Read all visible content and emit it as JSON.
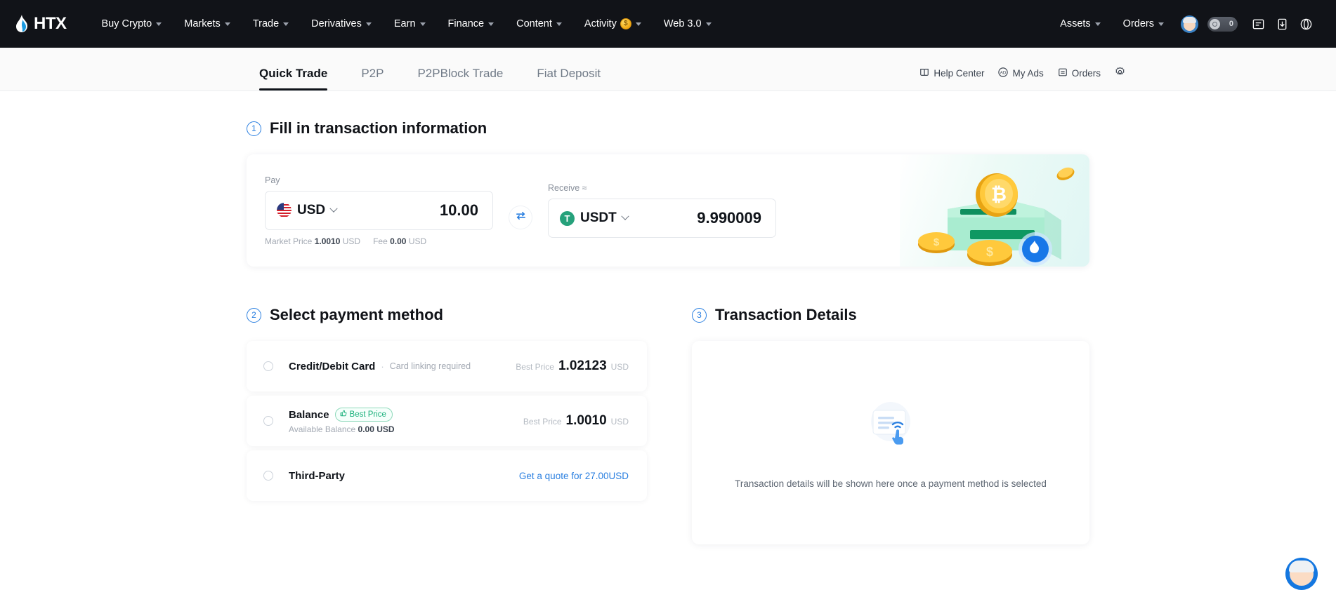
{
  "nav": {
    "brand": "HTX",
    "items": [
      {
        "label": "Buy Crypto",
        "caret": true
      },
      {
        "label": "Markets",
        "caret": true
      },
      {
        "label": "Trade",
        "caret": true
      },
      {
        "label": "Derivatives",
        "caret": true
      },
      {
        "label": "Earn",
        "caret": true
      },
      {
        "label": "Finance",
        "caret": true
      },
      {
        "label": "Content",
        "caret": true
      },
      {
        "label": "Activity",
        "caret": true,
        "badge": "$"
      },
      {
        "label": "Web 3.0",
        "caret": true
      }
    ],
    "right": {
      "assets": "Assets",
      "orders": "Orders",
      "pill_count": "0",
      "icons": [
        "avatar",
        "toggle-pill",
        "announcement-icon",
        "download-icon",
        "theme-icon"
      ]
    }
  },
  "subbar": {
    "tabs": [
      {
        "label": "Quick Trade",
        "active": true
      },
      {
        "label": "P2P",
        "active": false
      },
      {
        "label": "P2PBlock Trade",
        "active": false
      },
      {
        "label": "Fiat Deposit",
        "active": false
      }
    ],
    "links": [
      {
        "label": "Help Center",
        "icon": "book-icon"
      },
      {
        "label": "My Ads",
        "icon": "ad-icon"
      },
      {
        "label": "Orders",
        "icon": "orders-list-icon"
      }
    ],
    "settings_icon": "gear-icon"
  },
  "step1": {
    "number": "1",
    "title": "Fill in transaction information",
    "pay": {
      "label": "Pay",
      "currency": "USD",
      "currency_icon": "us-flag-icon",
      "amount": "10.00"
    },
    "receive": {
      "label": "Receive ≈",
      "currency": "USDT",
      "currency_icon": "usdt-icon",
      "amount": "9.990009"
    },
    "market_price_label": "Market Price",
    "market_price_value": "1.0010",
    "market_price_unit": "USD",
    "fee_label": "Fee",
    "fee_value": "0.00",
    "fee_unit": "USD",
    "swap_icon": "swap-arrows-icon"
  },
  "step2": {
    "number": "2",
    "title": "Select payment method",
    "methods": [
      {
        "name": "Credit/Debit Card",
        "separator": "·",
        "note": "Card linking required",
        "price_label": "Best Price",
        "price_value": "1.02123",
        "price_unit": "USD",
        "badge": null,
        "available": null,
        "link": null
      },
      {
        "name": "Balance",
        "separator": null,
        "note": null,
        "price_label": "Best Price",
        "price_value": "1.0010",
        "price_unit": "USD",
        "badge": "Best Price",
        "available_label": "Available Balance",
        "available_value": "0.00 USD",
        "link": null
      },
      {
        "name": "Third-Party",
        "separator": null,
        "note": null,
        "price_label": null,
        "price_value": null,
        "price_unit": null,
        "badge": null,
        "available": null,
        "link": "Get a quote for 27.00USD"
      }
    ]
  },
  "step3": {
    "number": "3",
    "title": "Transaction Details",
    "empty_text": "Transaction details will be shown here once a payment method is selected",
    "empty_icon": "document-tap-icon"
  },
  "fab": {
    "icon": "support-avatar-icon"
  },
  "colors": {
    "nav_bg": "#111318",
    "accent_blue": "#2a7fe0",
    "best_price_green": "#18b07a",
    "usdt_green": "#26a17b",
    "coin_gold": "#f0a812"
  }
}
